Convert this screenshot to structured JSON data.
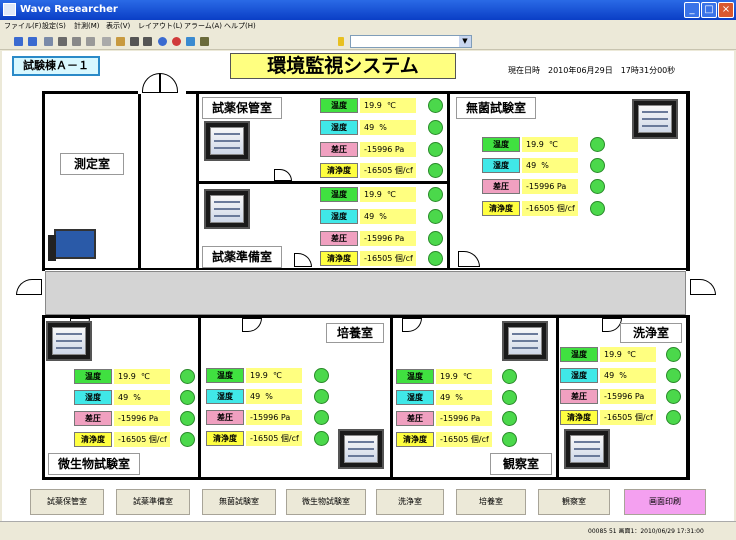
{
  "window": {
    "title": "Wave Researcher"
  },
  "menu": [
    "ファイル(F)",
    "設定(S)",
    "計測(M)",
    "表示(V)",
    "レイアウト(L)",
    "アラーム(A)",
    "ヘルプ(H)"
  ],
  "header": {
    "building": "試験棟Ａ－１",
    "system_title": "環境監視システム",
    "datetime": "現在日時　2010年06月29日　17時31分00秒"
  },
  "labels": {
    "temp": "温度",
    "humid": "湿度",
    "pressure": "差圧",
    "clean": "清浄度"
  },
  "colors": {
    "temp": "#40e040",
    "humid": "#40e8e8",
    "pressure": "#f0a0c0",
    "clean": "#ffff40",
    "value_bg": "#ffff80",
    "led": "#4bd84b"
  },
  "rooms": {
    "measure": "測定室",
    "reagent_storage": "試薬保管室",
    "reagent_prep": "試薬準備室",
    "sterile": "無菌試験室",
    "microbe": "微生物試験室",
    "culture": "培養室",
    "observe": "観察室",
    "wash": "洗浄室"
  },
  "readings": {
    "temp": "19.9  ℃",
    "humid": "49  %",
    "pressure": "-15996 Pa",
    "clean": "-16505 個/cf"
  },
  "nav": [
    "試薬保管室",
    "試薬準備室",
    "無菌試験室",
    "微生物試験室",
    "洗浄室",
    "培養室",
    "観察室",
    "画面印刷"
  ],
  "status": {
    "text": "00085 51  画面1：2010/06/29  17:31:00"
  }
}
